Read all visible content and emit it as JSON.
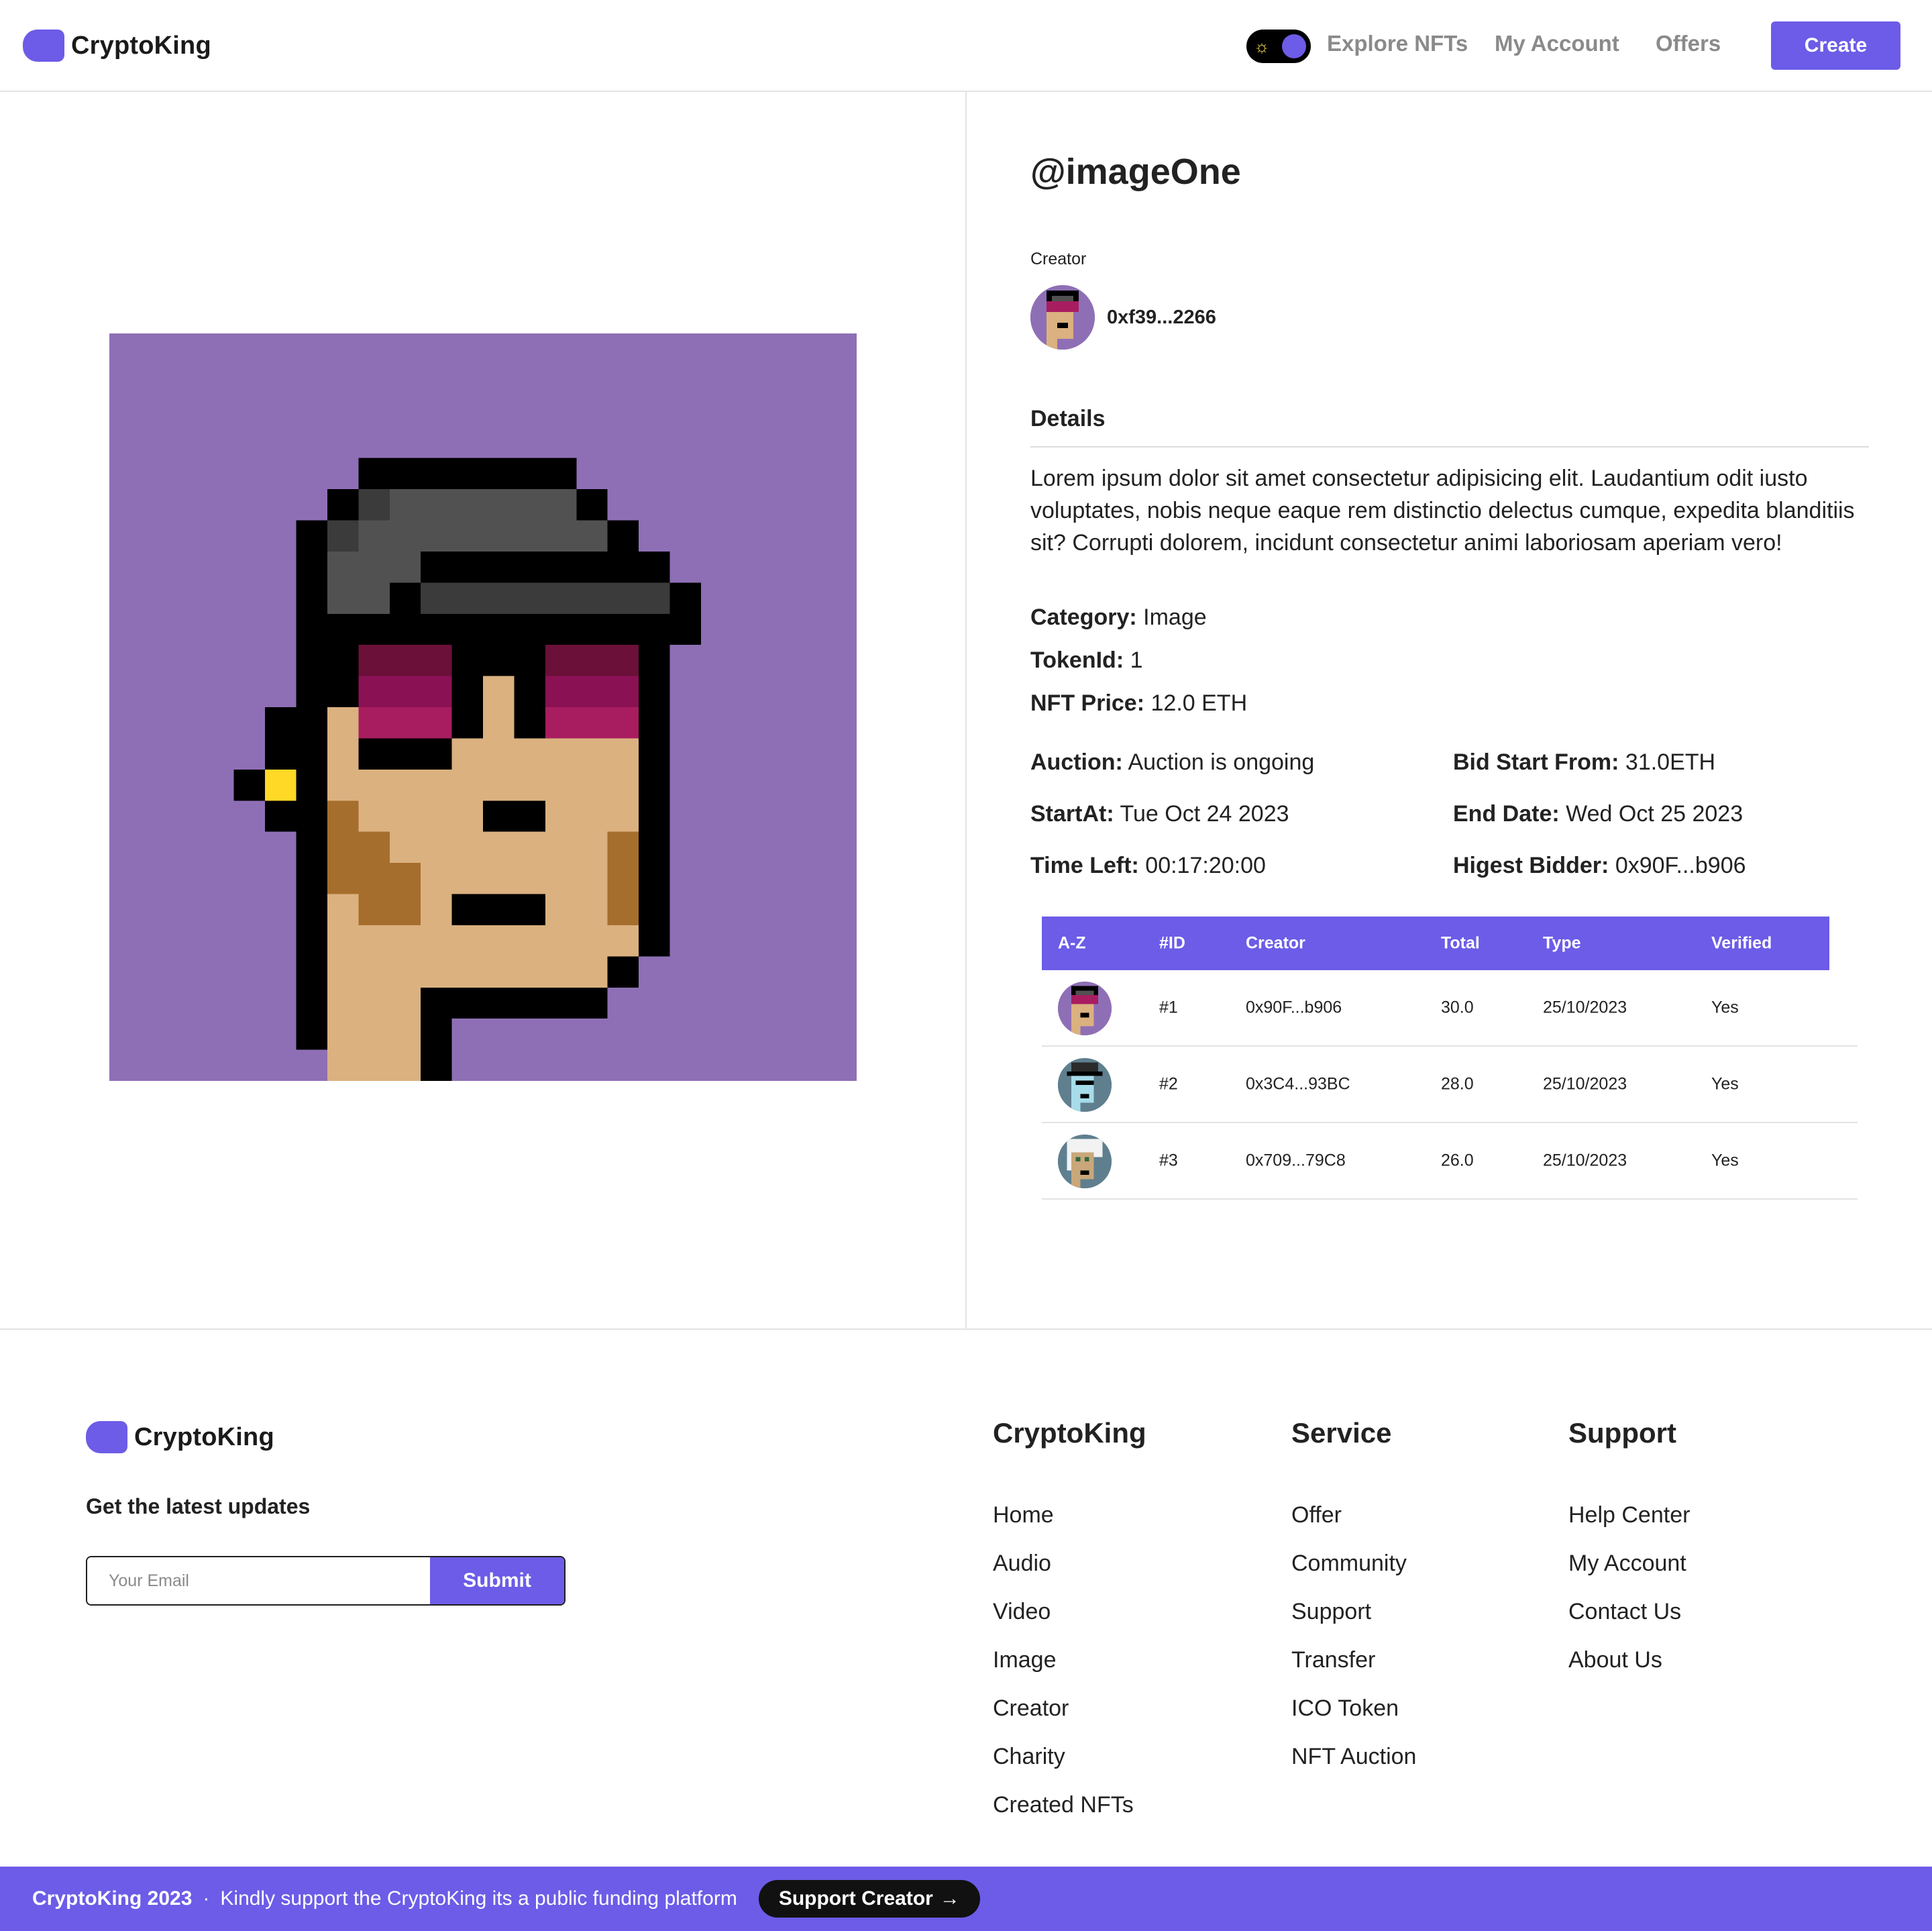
{
  "header": {
    "logo_text": "CryptoKing",
    "theme_toggle_icon": "sun-icon",
    "nav": [
      "Explore NFTs",
      "My Account",
      "Offers"
    ],
    "create_label": "Create"
  },
  "nft": {
    "title": "@imageOne",
    "creator_label": "Creator",
    "creator_address": "0xf39...2266",
    "details_heading": "Details",
    "description": "Lorem ipsum dolor sit amet consectetur adipisicing elit. Laudantium odit iusto voluptates, nobis neque eaque rem distinctio delectus cumque, expedita blanditiis sit? Corrupti dolorem, incidunt consectetur animi laboriosam aperiam vero!",
    "category_label": "Category:",
    "category": "Image",
    "tokenid_label": "TokenId:",
    "tokenid": "1",
    "price_label": "NFT Price:",
    "price": "12.0 ETH",
    "auction_label": "Auction:",
    "auction": "Auction is ongoing",
    "bid_start_label": "Bid Start From:",
    "bid_start": "31.0ETH",
    "start_label": "StartAt:",
    "start": "Tue Oct 24 2023",
    "end_label": "End Date:",
    "end": "Wed Oct 25 2023",
    "time_left_label": "Time Left:",
    "time_left": "00:17:20:00",
    "highest_label": "Higest Bidder:",
    "highest": "0x90F...b906"
  },
  "bids": {
    "headers": [
      "A-Z",
      "#ID",
      "Creator",
      "Total",
      "Type",
      "Verified"
    ],
    "rows": [
      {
        "id": "#1",
        "creator": "0x90F...b906",
        "total": "30.0",
        "type": "25/10/2023",
        "verified": "Yes"
      },
      {
        "id": "#2",
        "creator": "0x3C4...93BC",
        "total": "28.0",
        "type": "25/10/2023",
        "verified": "Yes"
      },
      {
        "id": "#3",
        "creator": "0x709...79C8",
        "total": "26.0",
        "type": "25/10/2023",
        "verified": "Yes"
      }
    ]
  },
  "footer": {
    "logo_text": "CryptoKing",
    "updates_label": "Get the latest updates",
    "email_placeholder": "Your Email",
    "submit_label": "Submit",
    "columns": [
      {
        "title": "CryptoKing",
        "links": [
          "Home",
          "Audio",
          "Video",
          "Image",
          "Creator",
          "Charity",
          "Created NFTs"
        ]
      },
      {
        "title": "Service",
        "links": [
          "Offer",
          "Community",
          "Support",
          "Transfer",
          "ICO Token",
          "NFT Auction"
        ]
      },
      {
        "title": "Support",
        "links": [
          "Help Center",
          "My Account",
          "Contact Us",
          "About Us"
        ]
      }
    ]
  },
  "bottom_bar": {
    "brand": "CryptoKing 2023",
    "separator": "·",
    "message": "Kindly support the CryptoKing its a public funding platform",
    "button_label": "Support Creator",
    "button_icon": "arrow-right-icon"
  },
  "colors": {
    "accent": "#6c5ce7",
    "nft_background": "#8e6fb5"
  }
}
